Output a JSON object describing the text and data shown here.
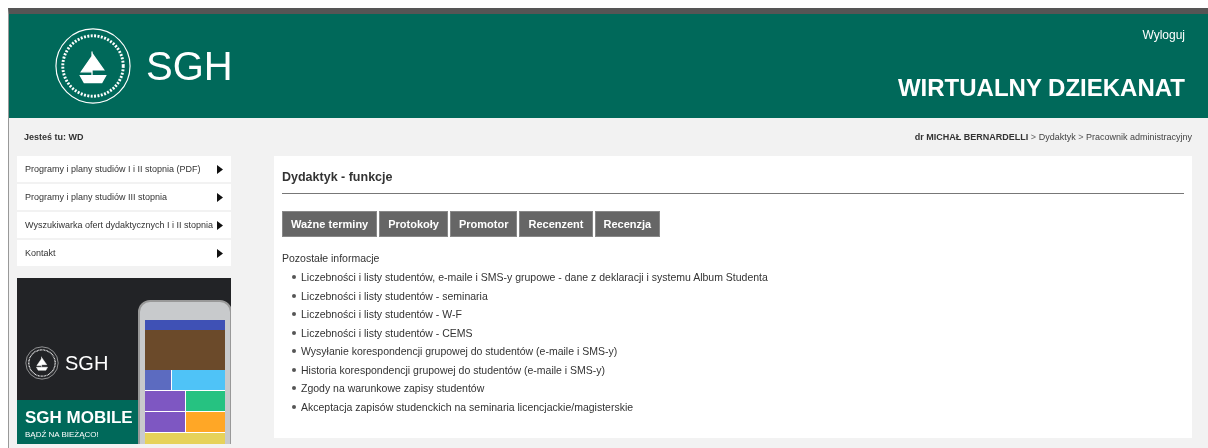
{
  "header": {
    "logo_text": "SGH",
    "logout": "Wyloguj",
    "title": "WIRTUALNY DZIEKANAT"
  },
  "breadcrumb": {
    "location": "Jesteś tu: WD",
    "user": "dr MICHAŁ BERNARDELLI",
    "path": [
      "Dydaktyk",
      "Pracownik administracyjny"
    ],
    "separator": ">"
  },
  "sidebar": {
    "items": [
      {
        "label": "Programy i plany studiów I i II stopnia (PDF)"
      },
      {
        "label": "Programy i plany studiów III stopnia"
      },
      {
        "label": "Wyszukiwarka ofert dydaktycznych I i II stopnia"
      },
      {
        "label": "Kontakt"
      }
    ],
    "banner": {
      "logo_text": "SGH",
      "title": "SGH MOBILE",
      "subtitle": "BĄDŹ NA BIEŻĄCO!"
    }
  },
  "main": {
    "title": "Dydaktyk - funkcje",
    "buttons": [
      "Ważne terminy",
      "Protokoły",
      "Promotor",
      "Recenzent",
      "Recenzja"
    ],
    "section_label": "Pozostałe informacje",
    "links": [
      "Liczebności i listy studentów, e-maile i SMS-y grupowe - dane z deklaracji i systemu Album Studenta",
      "Liczebności i listy studentów - seminaria",
      "Liczebności i listy studentów - W-F",
      "Liczebności i listy studentów - CEMS",
      "Wysyłanie korespondencji grupowej do studentów (e-maile i SMS-y)",
      "Historia korespondencji grupowej do studentów (e-maile i SMS-y)",
      "Zgody na warunkowe zapisy studentów",
      "Akceptacja zapisów studenckich na seminaria licencjackie/magisterskie"
    ]
  }
}
